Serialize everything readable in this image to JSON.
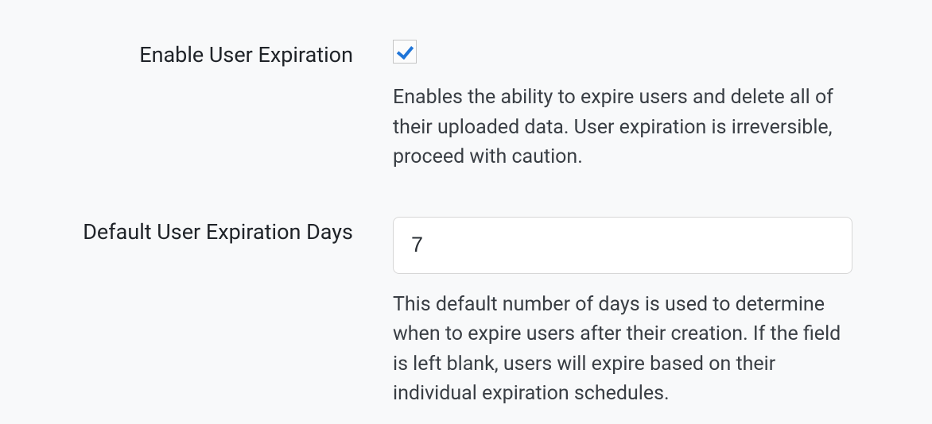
{
  "form": {
    "enableExpiration": {
      "label": "Enable User Expiration",
      "checked": "true",
      "help": "Enables the ability to expire users and delete all of their uploaded data. User expiration is irreversible, proceed with caution."
    },
    "defaultDays": {
      "label": "Default User Expiration Days",
      "value": "7",
      "help": "This default number of days is used to determine when to expire users after their creation. If the field is left blank, users will expire based on their individual expiration schedules."
    }
  }
}
